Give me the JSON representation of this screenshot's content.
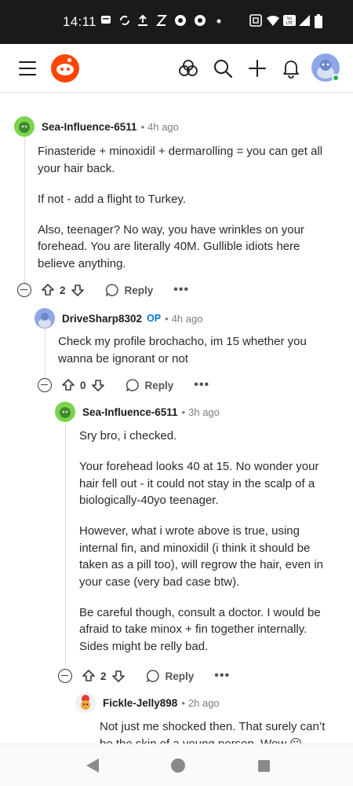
{
  "status_bar": {
    "time": "14:11",
    "icons": [
      "notification-icon",
      "sync-icon",
      "upload-icon",
      "x-icon",
      "chrome-icon",
      "chrome-icon",
      "dot",
      "nfc-icon",
      "wifi-icon",
      "volte-icon",
      "signal-icon",
      "battery-icon"
    ]
  },
  "header": {
    "icons": [
      "menu-icon",
      "reddit-logo",
      "communities-icon",
      "search-icon",
      "create-icon",
      "notifications-icon",
      "user-avatar"
    ]
  },
  "comments": [
    {
      "username": "Sea-Influence-6511",
      "op_badge": "",
      "time": "4h ago",
      "paragraphs": [
        "Finasteride + minoxidil + dermarolling = you can get all your hair back.",
        "If not - add a flight to Turkey.",
        "Also, teenager? No way, you have wrinkles on your forehead. You are literally 40M. Gullible idiots here believe anything."
      ],
      "votes": "2",
      "reply_label": "Reply"
    },
    {
      "username": "DriveSharp8302",
      "op_badge": "OP",
      "time": "4h ago",
      "paragraphs": [
        "Check my profile brochacho, im 15 whether you wanna be ignorant or not"
      ],
      "votes": "0",
      "reply_label": "Reply"
    },
    {
      "username": "Sea-Influence-6511",
      "op_badge": "",
      "time": "3h ago",
      "paragraphs": [
        "Sry bro, i checked.",
        "Your forehead looks 40 at 15. No wonder your hair fell out - it could not stay in the scalp of a biologically-40yo teenager.",
        "However, what i wrote above is true, using internal fin, and minoxidil (i think it should be taken as a pill too), will regrow the hair, even in your case (very bad case btw).",
        "Be careful though, consult a doctor. I would be afraid to take minox + fin together internally. Sides might be relly bad."
      ],
      "votes": "2",
      "reply_label": "Reply"
    },
    {
      "username": "Fickle-Jelly898",
      "op_badge": "",
      "time": "2h ago",
      "paragraphs": [
        "Not just me shocked then. That surely can’t be the skin of a young person. Wow 😮"
      ]
    }
  ],
  "colors": {
    "brand": "#ff4500",
    "op_badge": "#0079d3",
    "online": "#2ab24a"
  }
}
